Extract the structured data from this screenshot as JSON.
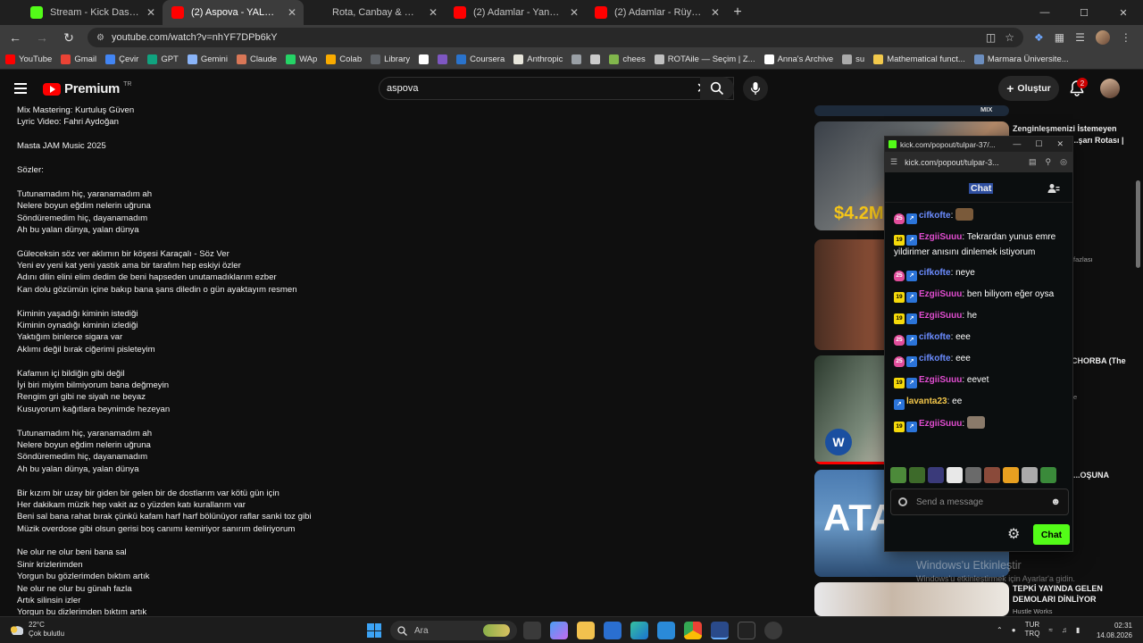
{
  "browser": {
    "tabs": [
      {
        "title": "Stream - Kick Dashboard",
        "favicon": "kick",
        "active": false
      },
      {
        "title": "(2) Aspova - YALAN DÜNYA (Ly",
        "favicon": "youtube",
        "active": true
      },
      {
        "title": "Rota, Canbay & Wolker, CATO",
        "favicon": "none",
        "active": false
      },
      {
        "title": "(2) Adamlar - Yanmış İçinden (C",
        "favicon": "youtube",
        "active": false
      },
      {
        "title": "(2) Adamlar - Rüyalarda Buruş",
        "favicon": "youtube",
        "active": false
      }
    ],
    "new_tab": "+",
    "url": "youtube.com/watch?v=nhYF7DPb6kY",
    "bookmarks": [
      {
        "label": "YouTube",
        "color": "#ff0000"
      },
      {
        "label": "Gmail",
        "color": "#ea4335"
      },
      {
        "label": "Çevir",
        "color": "#4285f4"
      },
      {
        "label": "GPT",
        "color": "#10a37f"
      },
      {
        "label": "Gemini",
        "color": "#8ab4f8"
      },
      {
        "label": "Claude",
        "color": "#d97757"
      },
      {
        "label": "WAp",
        "color": "#25d366"
      },
      {
        "label": "Colab",
        "color": "#f9ab00"
      },
      {
        "label": "Library",
        "color": "#5f6368"
      },
      {
        "label": "",
        "color": "#ffffff"
      },
      {
        "label": "",
        "color": "#7e57c2"
      },
      {
        "label": "Coursera",
        "color": "#2a73cc"
      },
      {
        "label": "Anthropic",
        "color": "#e8e6dc"
      },
      {
        "label": "",
        "color": "#9aa0a6"
      },
      {
        "label": "",
        "color": "#cccccc"
      },
      {
        "label": "chees",
        "color": "#81b64c"
      },
      {
        "label": "ROTAile — Seçim | Z...",
        "color": "#c0c0c0"
      },
      {
        "label": "Anna's Archive",
        "color": "#ffffff"
      },
      {
        "label": "su",
        "color": "#aaaaaa"
      },
      {
        "label": "Mathematical funct...",
        "color": "#f2c94c"
      },
      {
        "label": "Marmara Üniversite...",
        "color": "#6c8ebf"
      }
    ]
  },
  "youtube": {
    "logo": "Premium",
    "logo_region": "TR",
    "search_value": "aspova",
    "create_label": "Oluştur",
    "notif_count": "2"
  },
  "description": {
    "lines": [
      "Mix Mastering: Kurtuluş Güven",
      "Lyric Video: Fahri Aydoğan",
      "",
      "Masta JAM Music 2025",
      "",
      "Sözler:",
      "",
      "Tutunamadım hiç, yaranamadım ah",
      "Nelere boyun eğdim nelerin uğruna",
      "Söndüremedim hiç, dayanamadım",
      "Ah bu yalan dünya, yalan dünya",
      "",
      "Güleceksin söz ver aklımın bir köşesi Karaçalı - Söz Ver",
      "Yeni ev yeni kat yeni yastık ama bir tarafım hep eskiyi özler",
      "Adını dilin elini elim dedim de beni hapseden unutamadıklarım ezber",
      "Kan dolu gözümün içine bakıp bana şans diledin o gün ayaktayım resmen",
      "",
      "Kiminin yaşadığı kiminin istediği",
      "Kiminin oynadığı kiminin izlediği",
      "Yaktığım binlerce sigara var",
      "Aklımı değil bırak ciğerimi pisleteyim",
      "",
      "Kafamın içi bildiğin gibi değil",
      "İyi biri miyim bilmiyorum bana değmeyin",
      "Rengim gri gibi ne siyah ne beyaz",
      "Kusuyorum kağıtlara beynimde hezeyan",
      "",
      "Tutunamadım hiç, yaranamadım ah",
      "Nelere boyun eğdim nelerin uğruna",
      "Söndüremedim hiç, dayanamadım",
      "Ah bu yalan dünya, yalan dünya",
      "",
      "Bir kızım bir uzay bir giden bir gelen bir de dostlarım var kötü gün için",
      "Her dakikam müzik hep vakit az o yüzden katı kurallarım var",
      "Beni sal bana rahat bırak çünkü kafam harf harf bölünüyor raflar sanki toz gibi",
      "Müzik overdose gibi olsun gerisi boş canımı kemiriyor sanırım deliriyorum",
      "",
      "Ne olur ne olur beni bana sal",
      "Sinir krizlerimden",
      "Yorgun bu gözlerimden bıktım artık",
      "Ne olur ne olur bu günah fazla",
      "Artık silinsin izler",
      "Yorgun bu dizlerimden bıktım artık"
    ]
  },
  "recommendations": {
    "mix_label": "MIX",
    "items": [
      {
        "title_line1": "Zenginleşmenizi İstemeyen",
        "title_line2": "...şarı Rotası |",
        "meta": "",
        "badge": "$4.2M"
      },
      {
        "title_line1": "",
        "title_line2": "",
        "meta": "fazlası",
        "badge": ""
      },
      {
        "title_line1": "CHORBA (The",
        "title_line2": "",
        "meta": "e",
        "badge": ""
      },
      {
        "title_line1": "...OŞUNA",
        "title_line2": "",
        "meta": "",
        "badge": "ATA"
      },
      {
        "title_line1": "TEPKİ YAYINDA GELEN",
        "title_line2": "DEMOLARI DİNLİYOR",
        "meta": "Hustle Works",
        "badge": ""
      }
    ]
  },
  "kick_popout": {
    "window_title": "kick.com/popout/tulpar-37/...",
    "url": "kick.com/popout/tulpar-3...",
    "header": "Chat",
    "messages": [
      {
        "badge": "25",
        "badge_type": "sub-pink",
        "user": "cifkofte",
        "user_color": "#6b8cff",
        "text": "",
        "emote": "#7a5a3a"
      },
      {
        "badge": "19",
        "badge_type": "sub-yellow",
        "user": "EzgiiSuuu",
        "user_color": "#e14dd0",
        "text": "Tekrardan yunus emre yildirimer anısını dinlemek istiyorum",
        "emote": ""
      },
      {
        "badge": "25",
        "badge_type": "sub-pink",
        "user": "cifkofte",
        "user_color": "#6b8cff",
        "text": "neye",
        "emote": ""
      },
      {
        "badge": "19",
        "badge_type": "sub-yellow",
        "user": "EzgiiSuuu",
        "user_color": "#e14dd0",
        "text": "ben biliyom eğer oysa",
        "emote": ""
      },
      {
        "badge": "19",
        "badge_type": "sub-yellow",
        "user": "EzgiiSuuu",
        "user_color": "#e14dd0",
        "text": "he",
        "emote": ""
      },
      {
        "badge": "25",
        "badge_type": "sub-pink",
        "user": "cifkofte",
        "user_color": "#6b8cff",
        "text": "eee",
        "emote": ""
      },
      {
        "badge": "25",
        "badge_type": "sub-pink",
        "user": "cifkofte",
        "user_color": "#6b8cff",
        "text": "eee",
        "emote": ""
      },
      {
        "badge": "19",
        "badge_type": "sub-yellow",
        "user": "EzgiiSuuu",
        "user_color": "#e14dd0",
        "text": "eevet",
        "emote": ""
      },
      {
        "badge": "",
        "badge_type": "",
        "user": "lavanta23",
        "user_color": "#f2c64a",
        "text": "ee",
        "emote": ""
      },
      {
        "badge": "19",
        "badge_type": "sub-yellow",
        "user": "EzgiiSuuu",
        "user_color": "#e14dd0",
        "text": "",
        "emote": "#8a7a6a"
      }
    ],
    "emote_colors": [
      "#4c8a3a",
      "#3d6a2a",
      "#3a3a7a",
      "#e8e8e8",
      "#6a6a6a",
      "#8a4a3a",
      "#e8a020",
      "#aaaaaa",
      "#3a8a3a"
    ],
    "send_placeholder": "Send a message",
    "chat_button": "Chat",
    "accent": "#53fc18"
  },
  "watermark": {
    "line1": "Windows'u Etkinleştir",
    "line2": "Windows'u etkinleştirmek için Ayarlar'a gidin."
  },
  "taskbar": {
    "temp": "22°C",
    "weather": "Çok bulutlu",
    "search_placeholder": "Ara",
    "lang_top": "TUR",
    "lang_bottom": "TRQ",
    "time": "02:31",
    "date": "14.08.2026"
  }
}
